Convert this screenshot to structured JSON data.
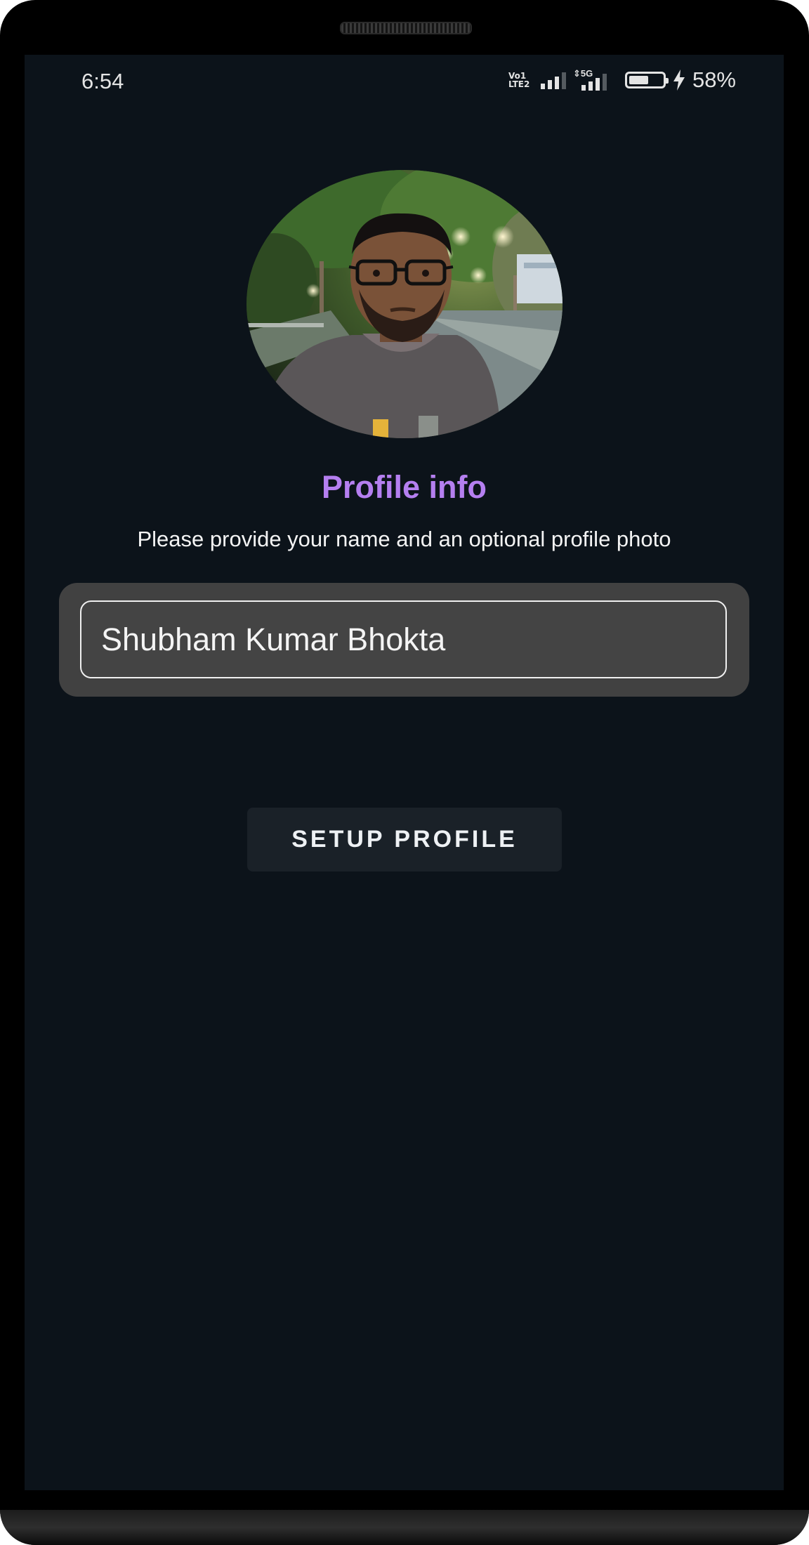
{
  "status_bar": {
    "time": "6:54",
    "volte_line1": "Vo",
    "volte_line2": "LTE",
    "sim1_marker": "1",
    "sim2_marker": "2",
    "network_label": "5G",
    "battery_percent": "58%",
    "battery_level": 0.58,
    "charging": true
  },
  "profile": {
    "avatar_icon": "profile-photo",
    "title": "Profile info",
    "subtitle": "Please provide your name and an optional profile photo",
    "name_value": "Shubham Kumar Bhokta",
    "setup_button_label": "SETUP PROFILE"
  },
  "colors": {
    "screen_bg": "#0c131a",
    "title_accent": "#b57ff0",
    "card_bg": "#414141",
    "button_bg": "#1a2128"
  }
}
